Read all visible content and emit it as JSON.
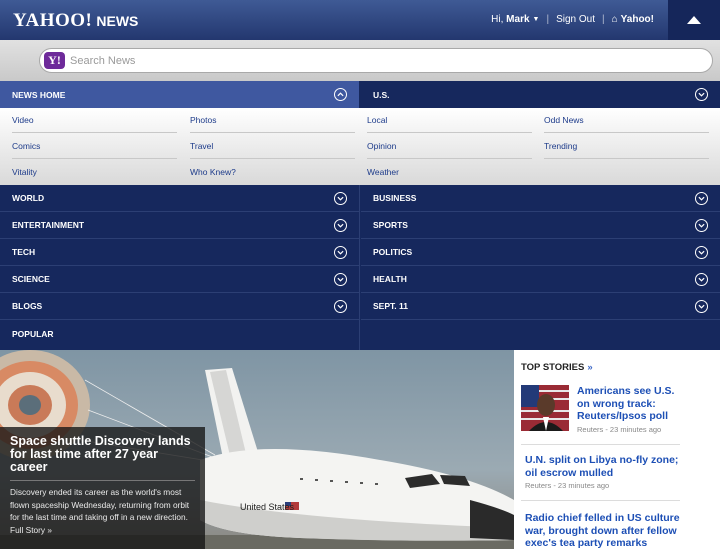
{
  "header": {
    "logo_text": "YAHOO!",
    "logo_sub": "NEWS",
    "greeting": "Hi,",
    "user_name": "Mark",
    "sign_out": "Sign Out",
    "home_link": "Yahoo!"
  },
  "search": {
    "placeholder": "Search News",
    "badge": "Y!"
  },
  "nav": {
    "news_home": "NEWS HOME",
    "us": "U.S.",
    "submenu": {
      "col1": [
        "Video",
        "Comics",
        "Vitality"
      ],
      "col2": [
        "Photos",
        "Travel",
        "Who Knew?"
      ],
      "col3": [
        "Local",
        "Opinion",
        "Weather"
      ],
      "col4": [
        "Odd News",
        "Trending"
      ]
    },
    "left": [
      "WORLD",
      "ENTERTAINMENT",
      "TECH",
      "SCIENCE",
      "BLOGS",
      "POPULAR"
    ],
    "right": [
      "BUSINESS",
      "SPORTS",
      "POLITICS",
      "HEALTH",
      "SEPT. 11"
    ]
  },
  "hero": {
    "title": "Space shuttle Discovery lands for last time after 27 year career",
    "text": "Discovery ended its career as the world's most flown spaceship Wednesday, returning from orbit for the last time and taking off in a new direction. Full Story »",
    "shuttle_label": "United States"
  },
  "top_stories": {
    "heading": "TOP STORIES",
    "more": "»",
    "items": [
      {
        "title": "Americans see U.S. on wrong track: Reuters/Ipsos poll",
        "meta": "Reuters - 23 minutes ago"
      },
      {
        "title": "U.N. split on Libya no-fly zone; oil escrow mulled",
        "meta": "Reuters - 23 minutes ago"
      },
      {
        "title": "Radio chief felled in US culture war, brought down after fellow exec's tea party remarks",
        "meta": ""
      }
    ]
  },
  "colors": {
    "header": "#2c4380",
    "nav": "#16285d",
    "nav_active": "#3f58a0",
    "link": "#1d4fb5"
  }
}
